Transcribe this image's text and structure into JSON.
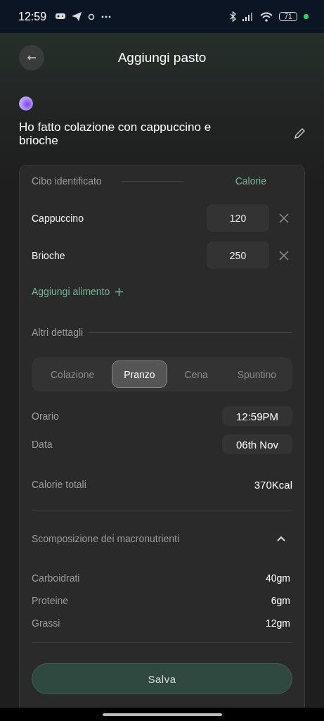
{
  "status_bar": {
    "time": "12:59",
    "battery": "71"
  },
  "header": {
    "title": "Aggiungi pasto"
  },
  "prompt": {
    "text": "Ho fatto colazione con cappuccino e brioche"
  },
  "food_card": {
    "column_1": "Cibo identificato",
    "column_2": "Calorie",
    "items": [
      {
        "name": "Cappuccino",
        "calories": "120"
      },
      {
        "name": "Brioche",
        "calories": "250"
      }
    ],
    "add_label": "Aggiungi alimento"
  },
  "details": {
    "title": "Altri dettagli",
    "meal_tabs": [
      {
        "label": "Colazione",
        "selected": false
      },
      {
        "label": "Pranzo",
        "selected": true
      },
      {
        "label": "Cena",
        "selected": false
      },
      {
        "label": "Spuntino",
        "selected": false
      }
    ],
    "fields": [
      {
        "label": "Orario",
        "value": "12:59PM"
      },
      {
        "label": "Data",
        "value": "06th Nov"
      }
    ],
    "total": {
      "label": "Calorie totali",
      "value": "370Kcal"
    }
  },
  "macros": {
    "title": "Scomposizione dei macronutrienti",
    "expanded": true,
    "rows": [
      {
        "label": "Carboidrati",
        "value": "40gm"
      },
      {
        "label": "Proteine",
        "value": "6gm"
      },
      {
        "label": "Grassi",
        "value": "12gm"
      }
    ]
  },
  "save_button": "Salva"
}
